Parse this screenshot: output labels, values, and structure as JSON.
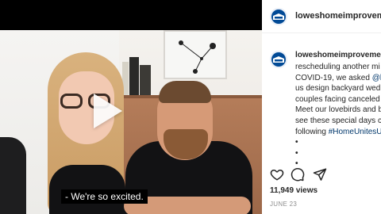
{
  "video": {
    "caption_text": "- We're so excited.",
    "play_icon": "play-icon"
  },
  "account": {
    "username_header": "loweshomeimprovemen",
    "username_post": "loweshomeimprovemen",
    "logo_icon": "lowes-logo",
    "brand_color": "#014a96"
  },
  "post": {
    "lines": [
      "rescheduling another mi",
      "COVID-19, we asked ",
      "us design backyard wed",
      "couples facing canceled",
      "Meet our lovebirds and b",
      "see these special days c",
      "following "
    ],
    "mention": "@b",
    "hashtag": "#HomeUnitesU",
    "bullets": [
      "•",
      "•",
      "•"
    ]
  },
  "actions": {
    "icons": [
      "heart-icon",
      "comment-icon",
      "share-icon"
    ]
  },
  "stats": {
    "views": "11,949 views",
    "date": "JUNE 23"
  }
}
